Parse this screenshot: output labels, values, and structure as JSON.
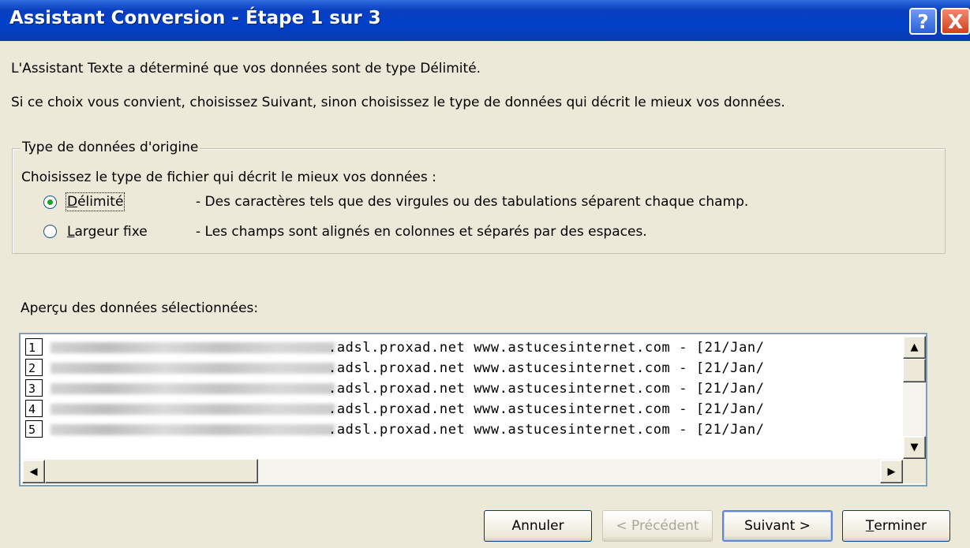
{
  "window": {
    "title": "Assistant Conversion - Étape 1 sur 3",
    "help_glyph": "?",
    "close_glyph": "X"
  },
  "intro": {
    "line1": "L'Assistant Texte a déterminé que vos données sont de type Délimité.",
    "line2": "Si ce choix vous convient, choisissez Suivant, sinon choisissez le type de données qui décrit le mieux vos données."
  },
  "group": {
    "legend": "Type de données d'origine",
    "prompt": "Choisissez le type de fichier qui décrit le mieux vos données :",
    "options": [
      {
        "label": "Délimité",
        "mnemonic": "D",
        "rest": "élimité",
        "description": "- Des caractères tels que des virgules ou des tabulations séparent chaque champ.",
        "selected": true
      },
      {
        "label": "Largeur fixe",
        "mnemonic": "L",
        "rest": "argeur fixe",
        "description": "- Les champs sont alignés en colonnes et séparés par des espaces.",
        "selected": false
      }
    ]
  },
  "preview": {
    "label": "Aperçu des données sélectionnées:",
    "rows": [
      {
        "num": "1",
        "text": ".adsl.proxad.net www.astucesinternet.com - [21/Jan/"
      },
      {
        "num": "2",
        "text": ".adsl.proxad.net www.astucesinternet.com - [21/Jan/"
      },
      {
        "num": "3",
        "text": ".adsl.proxad.net www.astucesinternet.com - [21/Jan/"
      },
      {
        "num": "4",
        "text": ".adsl.proxad.net www.astucesinternet.com - [21/Jan/"
      },
      {
        "num": "5",
        "text": ".adsl.proxad.net www.astucesinternet.com - [21/Jan/"
      }
    ]
  },
  "buttons": {
    "cancel": "Annuler",
    "previous": "< Précédent",
    "next": "Suivant >",
    "finish_mnemonic": "T",
    "finish_rest": "erminer"
  }
}
